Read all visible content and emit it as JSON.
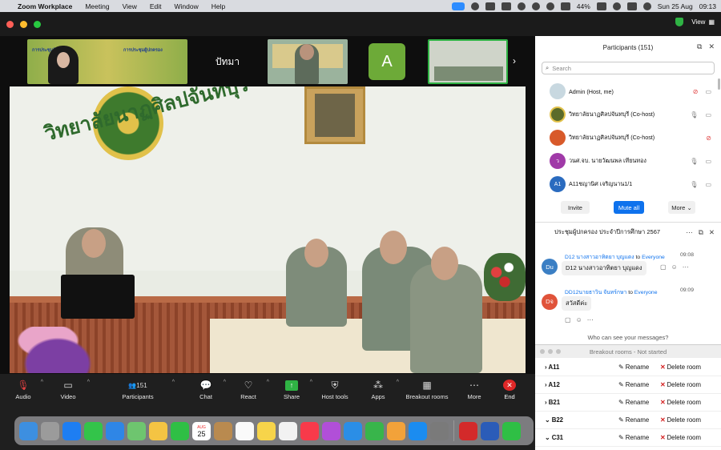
{
  "menubar": {
    "app": "Zoom Workplace",
    "items": [
      "Meeting",
      "View",
      "Edit",
      "Window",
      "Help"
    ],
    "battery": "44%",
    "date": "Sun 25 Aug",
    "time": "09:13"
  },
  "titlebar": {
    "view_label": "View"
  },
  "video_strip": {
    "tile1_labels": [
      "การประชุมผู้ปกครอง",
      "การประชุมผู้ปกครอง"
    ],
    "tile2_name": "ปัทมา",
    "tile4_initial": "A"
  },
  "main_video": {
    "wall_text": "วิทยาลัยนาฏศิลปจันทบุรี"
  },
  "toolbar": {
    "audio": "Audio",
    "video": "Video",
    "participants": "Participants",
    "participants_count": "151",
    "chat": "Chat",
    "react": "React",
    "share": "Share",
    "host_tools": "Host tools",
    "apps": "Apps",
    "breakout": "Breakout rooms",
    "more": "More",
    "end": "End"
  },
  "participants_panel": {
    "title": "Participants (151)",
    "search_placeholder": "Search",
    "rows": [
      {
        "name": "Admin (Host, me)",
        "avatar": "",
        "color": "#c8d8e0",
        "mic": "muted"
      },
      {
        "name": "วิทยาลัยนาฏศิลปจันทบุรี (Co-host)",
        "avatar": "",
        "color": "#5b6b2a",
        "mic": "on"
      },
      {
        "name": "วิทยาลัยนาฏศิลปจันทบุรี (Co-host)",
        "avatar": "",
        "color": "#d85a2a",
        "mic": "muted"
      },
      {
        "name": "วนศ.จบ. นายวัฒนพล เทียนทอง",
        "avatar": "ว",
        "color": "#a03aa8",
        "mic": "on"
      },
      {
        "name": "A11ชญานิศ เจริญนาน1/1",
        "avatar": "A1",
        "color": "#2a6bbf",
        "mic": "on"
      }
    ],
    "invite": "Invite",
    "mute_all": "Mute all",
    "more": "More"
  },
  "chat_panel": {
    "title": "ประชุมผู้ปกครอง ประจำปีการศึกษา 2567",
    "messages": [
      {
        "avatar": "Du",
        "color": "#3b7fc4",
        "sender": "D12 นางสาวอาทิตยา บุญแดง",
        "to": "to",
        "target": "Everyone",
        "time": "09:08",
        "text": "D12 นางสาวอาทิตยา บุญแดง"
      },
      {
        "avatar": "Dจ",
        "color": "#e0533a",
        "sender": "DD12นายธาวิน จันทร์กษา",
        "to": "to",
        "target": "Everyone",
        "time": "09:09",
        "text": "สวัสดีค่ะ"
      }
    ],
    "who_can_see": "Who can see your messages?"
  },
  "breakout_panel": {
    "title": "Breakout rooms - Not started",
    "rename": "Rename",
    "delete": "Delete room",
    "rooms": [
      "A11",
      "A12",
      "B21",
      "B22",
      "C31"
    ]
  },
  "dock": {
    "calendar_day": "25",
    "calendar_month": "AUG"
  }
}
